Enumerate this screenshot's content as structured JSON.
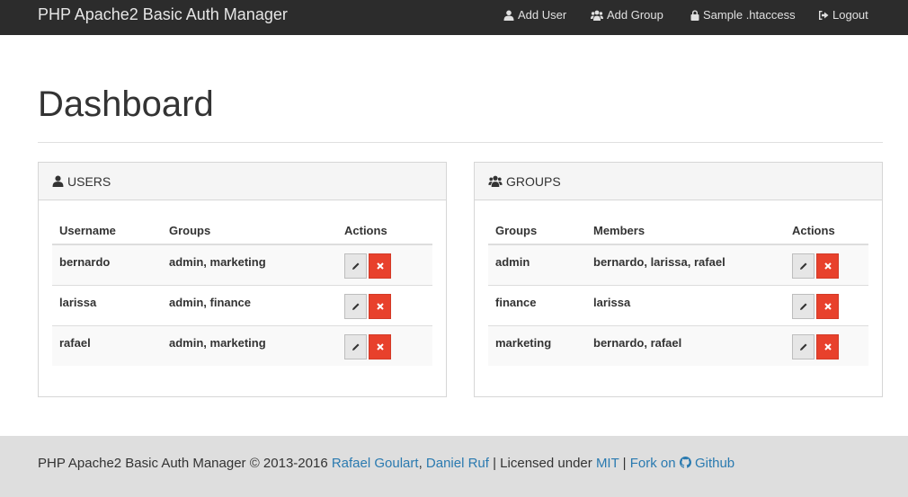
{
  "navbar": {
    "brand": "PHP Apache2 Basic Auth Manager",
    "add_user": "Add User",
    "add_group": "Add Group",
    "sample_htaccess": "Sample .htaccess",
    "logout": "Logout"
  },
  "page": {
    "title": "Dashboard"
  },
  "users_panel": {
    "title": "USERS",
    "headers": [
      "Username",
      "Groups",
      "Actions"
    ],
    "rows": [
      {
        "username": "bernardo",
        "groups": "admin, marketing"
      },
      {
        "username": "larissa",
        "groups": "admin, finance"
      },
      {
        "username": "rafael",
        "groups": "admin, marketing"
      }
    ]
  },
  "groups_panel": {
    "title": "GROUPS",
    "headers": [
      "Groups",
      "Members",
      "Actions"
    ],
    "rows": [
      {
        "group": "admin",
        "members": "bernardo, larissa, rafael"
      },
      {
        "group": "finance",
        "members": "larissa"
      },
      {
        "group": "marketing",
        "members": "bernardo, rafael"
      }
    ]
  },
  "footer": {
    "prefix": "PHP Apache2 Basic Auth Manager © 2013-2016 ",
    "author1": "Rafael Goulart",
    "comma": ", ",
    "author2": "Daniel Ruf",
    "licensed": " | Licensed under ",
    "license": "MIT",
    "sep": " | ",
    "fork_on": "Fork on ",
    "github": "Github"
  },
  "icons": {
    "user": "user-icon",
    "users": "users-icon",
    "lock": "lock-icon",
    "logout": "sign-out-icon",
    "edit": "pencil-icon",
    "delete": "close-icon",
    "github": "github-icon"
  },
  "colors": {
    "navbar_bg": "#2c2c2c",
    "delete_button": "#e8412c",
    "link": "#2a7ab0",
    "footer_bg": "#dedede"
  }
}
